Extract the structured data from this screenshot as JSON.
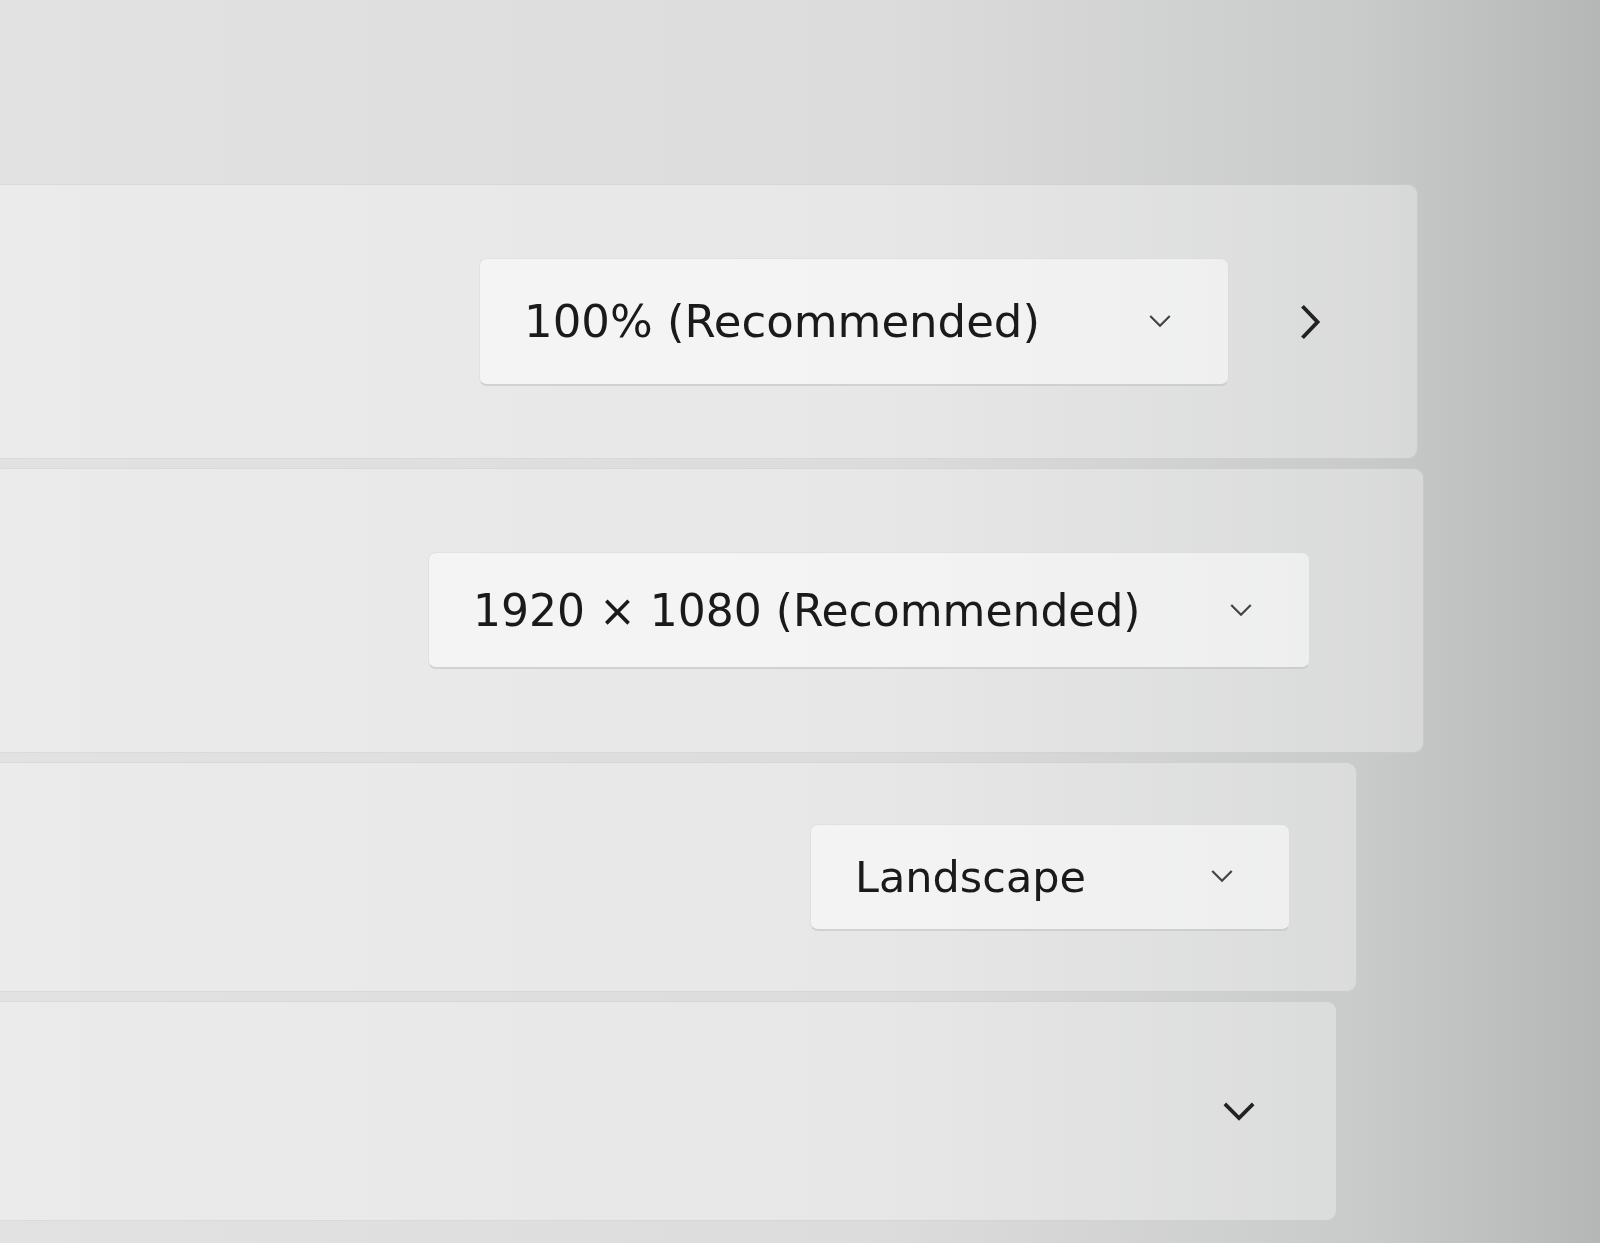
{
  "rows": [
    {
      "kind": "dropdown",
      "value": "100% (Recommended)",
      "navigates": true
    },
    {
      "kind": "dropdown",
      "value": "1920 × 1080 (Recommended)",
      "navigates": false
    },
    {
      "kind": "dropdown",
      "value": "Landscape",
      "navigates": false
    },
    {
      "kind": "expander",
      "expanded": false
    }
  ]
}
